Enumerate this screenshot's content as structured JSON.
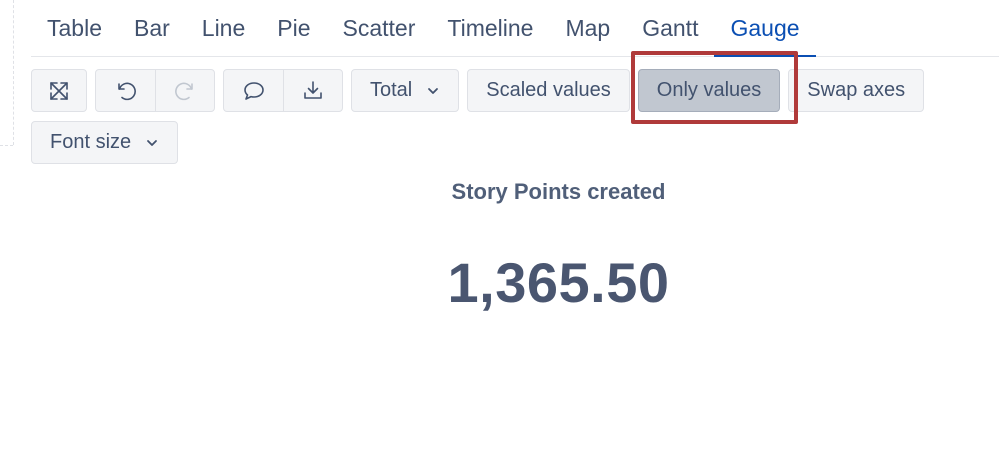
{
  "tabs": [
    {
      "label": "Table"
    },
    {
      "label": "Bar"
    },
    {
      "label": "Line"
    },
    {
      "label": "Pie"
    },
    {
      "label": "Scatter"
    },
    {
      "label": "Timeline"
    },
    {
      "label": "Map"
    },
    {
      "label": "Gantt"
    },
    {
      "label": "Gauge",
      "active": true
    }
  ],
  "toolbar": {
    "fullscreen_icon": "expand-arrows-icon",
    "undo_icon": "undo-icon",
    "redo_icon": "redo-icon",
    "comment_icon": "speech-bubble-icon",
    "download_icon": "download-icon",
    "total_label": "Total",
    "scaled_values_label": "Scaled values",
    "only_values_label": "Only values",
    "swap_axes_label": "Swap axes",
    "font_size_label": "Font size"
  },
  "gauge": {
    "title": "Story Points created",
    "value": "1,365.50"
  },
  "colors": {
    "active_tab": "#0b4fb3",
    "highlight": "#b03a3a",
    "text": "#42526e"
  }
}
